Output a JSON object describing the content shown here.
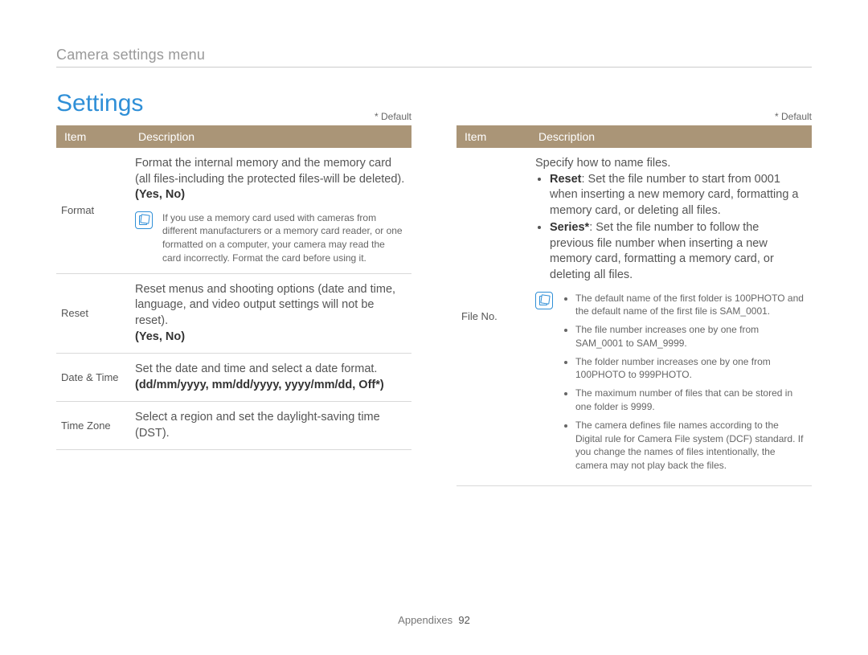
{
  "breadcrumb": "Camera settings menu",
  "heading": "Settings",
  "default_note": "* Default",
  "table_headers": {
    "item": "Item",
    "description": "Description"
  },
  "left": {
    "format": {
      "name": "Format",
      "desc": "Format the internal memory and the memory card (all files-including the protected files-will be deleted).",
      "opts": "(Yes, No)",
      "note": "If you use a memory card used with cameras from different manufacturers or a memory card reader, or one formatted on a computer, your camera may read the card incorrectly. Format the card before using it."
    },
    "reset": {
      "name": "Reset",
      "desc": "Reset menus and shooting options (date and time, language, and video output settings will not be reset).",
      "opts": "(Yes, No)"
    },
    "datetime": {
      "name": "Date & Time",
      "desc": "Set the date and time and select a date format.",
      "opts": "(dd/mm/yyyy, mm/dd/yyyy, yyyy/mm/dd, Off*)"
    },
    "timezone": {
      "name": "Time Zone",
      "desc": "Select a region and set the daylight-saving time (DST)."
    }
  },
  "right": {
    "fileno": {
      "name": "File No.",
      "intro": "Specify how to name files.",
      "reset_label": "Reset",
      "reset_text": ": Set the file number to start from 0001 when inserting a new memory card, formatting a memory card, or deleting all files.",
      "series_label": "Series*",
      "series_text": ": Set the file number to follow the previous file number when inserting a new memory card, formatting a memory card, or deleting all files.",
      "notes": [
        "The default name of the first folder is 100PHOTO and the default name of the first file is SAM_0001.",
        "The file number increases one by one from SAM_0001 to SAM_9999.",
        "The folder number increases one by one from 100PHOTO to 999PHOTO.",
        "The maximum number of files that can be stored in one folder is 9999.",
        "The camera defines file names according to the Digital rule for Camera File system (DCF) standard. If you change the names of files intentionally, the camera may not play back the files."
      ]
    }
  },
  "footer": {
    "section": "Appendixes",
    "page": "92"
  }
}
